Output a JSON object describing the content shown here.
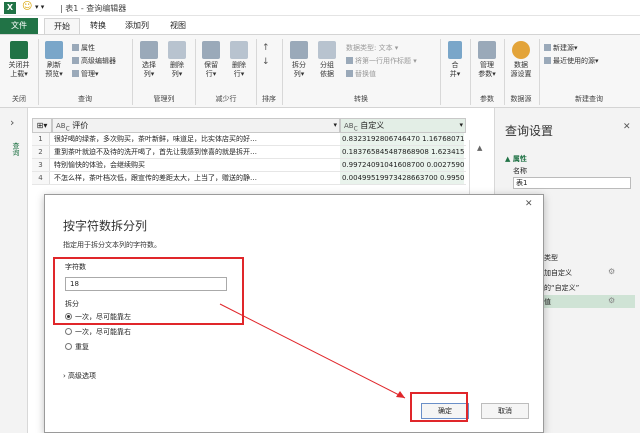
{
  "window": {
    "title": "| 表1 - 查询编辑器",
    "app_icon": "excel-icon",
    "face": "☺"
  },
  "tabs": [
    "文件",
    "开始",
    "转换",
    "添加列",
    "视图"
  ],
  "ribbon": {
    "close_group": {
      "btn": "关闭并\n上载▾",
      "label": "关闭"
    },
    "query_group": {
      "refresh": "刷新\n预览▾",
      "props": "属性",
      "adv_editor": "高级编辑器",
      "manage": "管理▾",
      "label": "查询"
    },
    "manage_cols_group": {
      "choose": "选择\n列▾",
      "remove": "删除\n列▾",
      "label": "管理列"
    },
    "reduce_rows_group": {
      "keep": "保留\n行▾",
      "delete": "删除\n行▾",
      "label": "减少行"
    },
    "sort_group": {
      "label": "排序"
    },
    "transform_group": {
      "split": "拆分\n列▾",
      "group_by": "分组\n依据",
      "datatype": "数据类型: 文本 ▾",
      "first_row": "将第一行用作标题 ▾",
      "replace": "替换值",
      "label": "转换"
    },
    "combine_group": {
      "merge": "合\n并▾"
    },
    "params_group": {
      "manage": "管理\n参数▾",
      "label": "参数"
    },
    "datasource_group": {
      "settings": "数据\n源设置",
      "label": "数据源"
    },
    "newquery_group": {
      "new_source": "新建源▾",
      "recent": "最近使用的源▾",
      "label": "新建查询"
    }
  },
  "left_pane": {
    "arrow": "›",
    "label": "查询"
  },
  "grid": {
    "col1_header": "评价",
    "col2_header": "自定义",
    "rows": [
      {
        "n": "1",
        "c1": "很好喝的绿茶，多次购买，茶叶新鲜，味道足，比实体店买的好…",
        "c2": "0.8323192806746470 1.1676807193253…"
      },
      {
        "n": "2",
        "c1": "重到茶叶就迫不及待的洗开喝了，首先让我感到惊喜的就是拆开…",
        "c2": "0.183765845487868908 1.6234154512…"
      },
      {
        "n": "3",
        "c1": "特别愉快的体验，会继续购买",
        "c2": "0.99724091041608700 0.0027590895839…"
      },
      {
        "n": "4",
        "c1": "不怎么样，茶叶档次低，跟宣传的差距太大，上当了，赠送的静…",
        "c2": "0.00499519973428663700 0.9950048002…"
      }
    ]
  },
  "right_pane": {
    "title": "查询设置",
    "props_section": "▲ 属性",
    "name_label": "名称",
    "name_value": "表1",
    "all_props": "性",
    "steps_title": "步骤",
    "steps": [
      "的类型",
      "添加自定义",
      "开的“自定义”",
      "数值"
    ]
  },
  "dialog": {
    "title": "按字符数拆分列",
    "subtitle": "指定用于拆分文本列的字符数。",
    "char_count_label": "字符数",
    "char_count_value": "18",
    "split_label": "拆分",
    "options": [
      "一次，尽可能靠左",
      "一次，尽可能靠右",
      "重复"
    ],
    "advanced": "› 高级选项",
    "ok": "确定",
    "cancel": "取消",
    "close": "✕"
  },
  "colors": {
    "excel_green": "#217346",
    "annotation_red": "#e0262a",
    "custom_col_bg": "#e9f3ec"
  }
}
